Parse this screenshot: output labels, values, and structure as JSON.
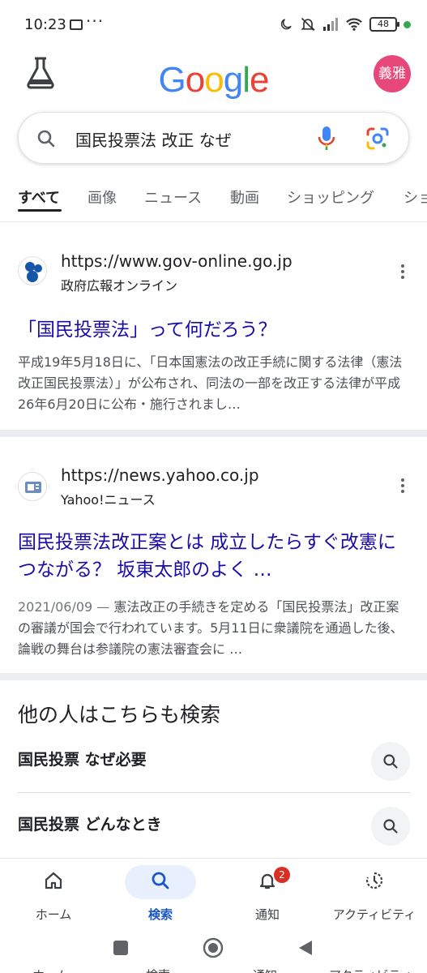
{
  "status_bar": {
    "time": "10:23",
    "dots": "···",
    "battery": "48"
  },
  "header": {
    "logo_letters": [
      {
        "char": "G",
        "color": "#4285f4"
      },
      {
        "char": "o",
        "color": "#ea4335"
      },
      {
        "char": "o",
        "color": "#fbbc05"
      },
      {
        "char": "g",
        "color": "#4285f4"
      },
      {
        "char": "l",
        "color": "#34a853"
      },
      {
        "char": "e",
        "color": "#ea4335"
      }
    ],
    "avatar_text": "義雅"
  },
  "search": {
    "query": "国民投票法 改正 なぜ"
  },
  "tabs": [
    {
      "label": "すべて",
      "active": true
    },
    {
      "label": "画像",
      "active": false
    },
    {
      "label": "ニュース",
      "active": false
    },
    {
      "label": "動画",
      "active": false
    },
    {
      "label": "ショッピング",
      "active": false
    },
    {
      "label": "ショ",
      "active": false
    }
  ],
  "results": [
    {
      "url": "https://www.gov-online.go.jp",
      "site_name": "政府広報オンライン",
      "title": "「国民投票法」って何だろう？",
      "date": "",
      "snippet": "平成19年5月18日に、「日本国憲法の改正手続に関する法律（憲法改正国民投票法）」が公布され、同法の一部を改正する法律が平成26年6月20日に公布・施行されまし…"
    },
    {
      "url": "https://news.yahoo.co.jp",
      "site_name": "Yahoo!ニュース",
      "title": "国民投票法改正案とは 成立したらすぐ改憲につながる？ 坂東太郎のよく …",
      "date": "2021/06/09 — ",
      "snippet": "憲法改正の手続きを定める「国民投票法」改正案の審議が国会で行われています。5月11日に衆議院を通過した後、論戦の舞台は参議院の憲法審査会に …"
    }
  ],
  "related": {
    "heading": "他の人はこちらも検索",
    "items": [
      {
        "label": "国民投票 なぜ必要"
      },
      {
        "label": "国民投票 どんなとき"
      }
    ]
  },
  "bottom_nav": {
    "items": [
      {
        "label": "ホーム",
        "icon": "home-icon",
        "active": false
      },
      {
        "label": "検索",
        "icon": "search-icon",
        "active": true
      },
      {
        "label": "通知",
        "icon": "bell-icon",
        "active": false,
        "badge": "2"
      },
      {
        "label": "アクティビティ",
        "icon": "history-icon",
        "active": false
      }
    ]
  },
  "ghost_labels": [
    "ホーム",
    "検索",
    "通知",
    "アクティビティ"
  ],
  "colors": {
    "link_blue": "#1a0dab",
    "accent_blue": "#1a56c8",
    "avatar_pink": "#e8477a"
  }
}
